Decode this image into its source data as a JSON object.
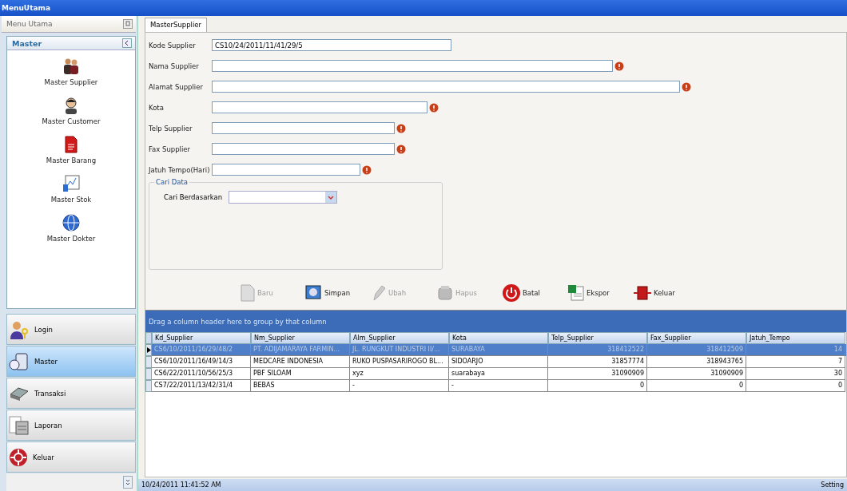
{
  "window": {
    "title": "MenuUtama"
  },
  "sidebar": {
    "header": "Menu Utama",
    "group": {
      "title": "Master",
      "items": [
        {
          "label": "Master Supplier"
        },
        {
          "label": "Master Customer"
        },
        {
          "label": "Master Barang"
        },
        {
          "label": "Master Stok"
        },
        {
          "label": "Master Dokter"
        }
      ]
    },
    "nav": [
      {
        "label": "Login",
        "selected": false
      },
      {
        "label": "Master",
        "selected": true
      },
      {
        "label": "Transaksi",
        "selected": false
      },
      {
        "label": "Laporan",
        "selected": false
      },
      {
        "label": "Keluar",
        "selected": false
      }
    ]
  },
  "tabs": [
    {
      "label": "MasterSupplier",
      "selected": true
    }
  ],
  "form": {
    "fields": [
      {
        "label": "Kode Supplier",
        "value": "CS10/24/2011/11/41/29/5",
        "required": false
      },
      {
        "label": "Nama Supplier",
        "required": true
      },
      {
        "label": "Alamat Supplier",
        "required": true
      },
      {
        "label": "Kota",
        "required": true
      },
      {
        "label": "Telp Supplier",
        "required": true
      },
      {
        "label": "Fax Supplier",
        "required": true
      },
      {
        "label": "Jatuh Tempo(Hari)",
        "required": true
      }
    ],
    "search": {
      "title": "Cari Data",
      "label": "Cari Berdasarkan"
    }
  },
  "toolbar": [
    {
      "label": "Baru",
      "disabled": true
    },
    {
      "label": "Simpan",
      "disabled": false
    },
    {
      "label": "Ubah",
      "disabled": true
    },
    {
      "label": "Hapus",
      "disabled": true
    },
    {
      "label": "Batal",
      "disabled": false
    },
    {
      "label": "Ekspor",
      "disabled": false
    },
    {
      "label": "Keluar",
      "disabled": false
    }
  ],
  "grid": {
    "group_hint": "Drag a column header here to group by that column",
    "columns": [
      {
        "label": "Kd_Supplier",
        "numeric": false
      },
      {
        "label": "Nm_Supplier",
        "numeric": false
      },
      {
        "label": "Alm_Supplier",
        "numeric": false
      },
      {
        "label": "Kota",
        "numeric": false
      },
      {
        "label": "Telp_Supplier",
        "numeric": true
      },
      {
        "label": "Fax_Supplier",
        "numeric": true
      },
      {
        "label": "Jatuh_Tempo",
        "numeric": true
      }
    ],
    "rows": [
      {
        "selected": true,
        "cells": [
          "CS6/10/2011/16/29/48/2",
          "PT. ADIJAMARAYA FARMIN...",
          "JL. RUNGKUT INDUSTRI II/...",
          "SURABAYA",
          "318412522",
          "318412509",
          "14"
        ]
      },
      {
        "selected": false,
        "cells": [
          "CS6/10/2011/16/49/14/3",
          "MEDCARE INDONESIA",
          "RUKO PUSPASARIROGO BL...",
          "SIDOARJO",
          "31857774",
          "318943765",
          "7"
        ]
      },
      {
        "selected": false,
        "cells": [
          "CS6/22/2011/10/56/25/3",
          "PBF SILOAM",
          "xyz",
          "suarabaya",
          "31090909",
          "31090909",
          "30"
        ]
      },
      {
        "selected": false,
        "cells": [
          "CS7/22/2011/13/42/31/4",
          "BEBAS",
          "-",
          "-",
          "0",
          "0",
          "0"
        ]
      }
    ]
  },
  "status_bar": {
    "time": "10/24/2011 11:41:52 AM",
    "setting": "Setting"
  }
}
